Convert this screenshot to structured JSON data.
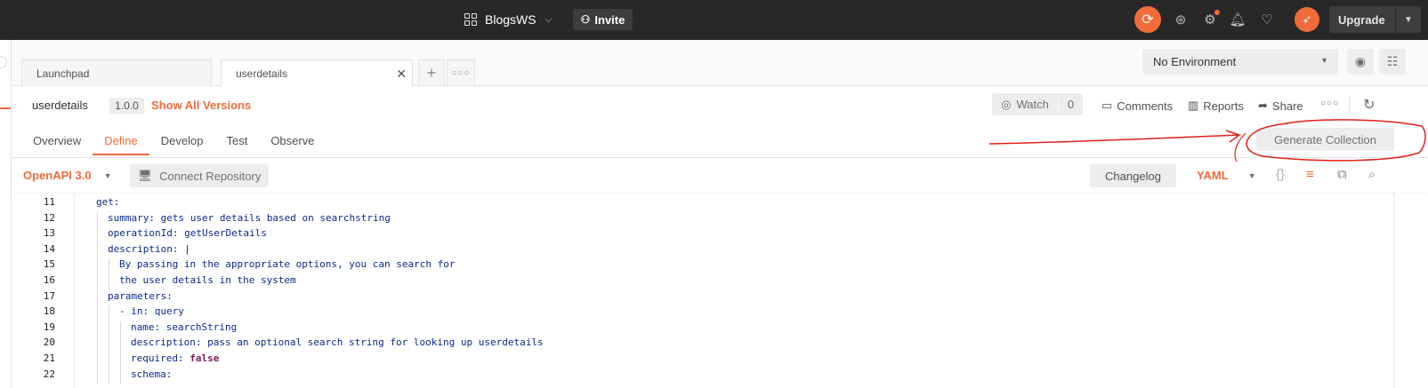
{
  "topbar": {
    "workspace_name": "BlogsWS",
    "invite_label": "Invite",
    "upgrade_label": "Upgrade",
    "accent_color": "#f26b3a"
  },
  "tabs": [
    {
      "label": "Launchpad"
    },
    {
      "label": "userdetails"
    }
  ],
  "environment": {
    "selected": "No Environment"
  },
  "api": {
    "name": "userdetails",
    "version": "1.0.0",
    "show_all_versions": "Show All Versions",
    "watch_label": "Watch",
    "watch_count": "0",
    "comments_label": "Comments",
    "reports_label": "Reports",
    "share_label": "Share"
  },
  "define_tabs": [
    {
      "label": "Overview",
      "active": false
    },
    {
      "label": "Define",
      "active": true
    },
    {
      "label": "Develop",
      "active": false
    },
    {
      "label": "Test",
      "active": false
    },
    {
      "label": "Observe",
      "active": false
    }
  ],
  "generate_collection_label": "Generate Collection",
  "toolbar": {
    "schema_type": "OpenAPI 3.0",
    "connect_repository": "Connect Repository",
    "changelog": "Changelog",
    "format": "YAML"
  },
  "editor": {
    "lines": [
      {
        "n": "11",
        "indent": 0,
        "key": "get",
        "sep": ":",
        "val": "",
        "val_type": "text"
      },
      {
        "n": "12",
        "indent": 1,
        "key": "summary",
        "sep": ":",
        "val": " gets user details based on searchstring",
        "val_type": "text"
      },
      {
        "n": "13",
        "indent": 1,
        "key": "operationId",
        "sep": ":",
        "val": " getUserDetails",
        "val_type": "text"
      },
      {
        "n": "14",
        "indent": 1,
        "key": "description",
        "sep": ":",
        "val": " |",
        "val_type": "text"
      },
      {
        "n": "15",
        "indent": 2,
        "key": "",
        "sep": "",
        "val": "By passing in the appropriate options, you can search for",
        "val_type": "text"
      },
      {
        "n": "16",
        "indent": 2,
        "key": "",
        "sep": "",
        "val": "the user details in the system",
        "val_type": "text"
      },
      {
        "n": "17",
        "indent": 1,
        "key": "parameters",
        "sep": ":",
        "val": "",
        "val_type": "text"
      },
      {
        "n": "18",
        "indent": 2,
        "key": "- in",
        "sep": ":",
        "val": " query",
        "val_type": "text"
      },
      {
        "n": "19",
        "indent": 3,
        "key": "name",
        "sep": ":",
        "val": " searchString",
        "val_type": "text"
      },
      {
        "n": "20",
        "indent": 3,
        "key": "description",
        "sep": ":",
        "val": " pass an optional search string for looking up userdetails",
        "val_type": "text"
      },
      {
        "n": "21",
        "indent": 3,
        "key": "required",
        "sep": ":",
        "val": "false",
        "val_type": "bool"
      },
      {
        "n": "22",
        "indent": 3,
        "key": "schema",
        "sep": ":",
        "val": "",
        "val_type": "text"
      }
    ]
  },
  "icons": {
    "workspace": "grid-icon",
    "invite": "person-add-icon",
    "sync": "sync-icon",
    "satellite": "satellite-icon",
    "settings": "gear-icon",
    "notifications": "bell-icon",
    "favorites": "heart-icon",
    "profile": "rocket-icon",
    "environment_quick_look": "eye-icon",
    "environment_settings": "sliders-icon",
    "watch": "eye-icon",
    "comments": "comment-icon",
    "reports": "bar-chart-icon",
    "share": "share-icon",
    "refresh": "refresh-icon",
    "connect": "repository-icon",
    "beautify": "braces-icon",
    "wrap": "wrap-lines-icon",
    "copy": "copy-icon",
    "search": "search-icon"
  }
}
